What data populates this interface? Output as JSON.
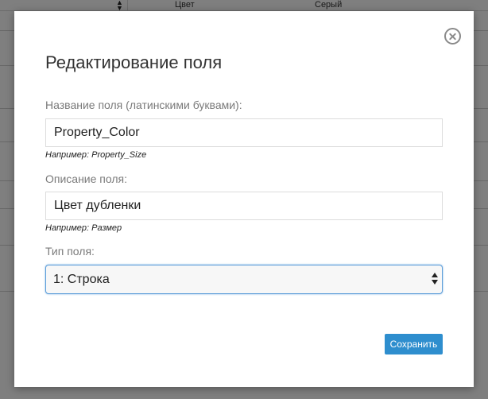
{
  "background": {
    "column_name": "Цвет",
    "column_value": "Серый"
  },
  "modal": {
    "title": "Редактирование поля",
    "close_icon": "close-circle-icon",
    "fields": {
      "name": {
        "label": "Название поля (латинскими буквами):",
        "value": "Property_Color",
        "hint": "Например: Property_Size"
      },
      "description": {
        "label": "Описание поля:",
        "value": "Цвет дубленки",
        "hint": "Например: Размер"
      },
      "type": {
        "label": "Тип поля:",
        "selected": "1: Строка"
      }
    },
    "save_label": "Сохранить"
  },
  "colors": {
    "accent": "#2e8ece",
    "focus_border": "#5b9dd9"
  }
}
